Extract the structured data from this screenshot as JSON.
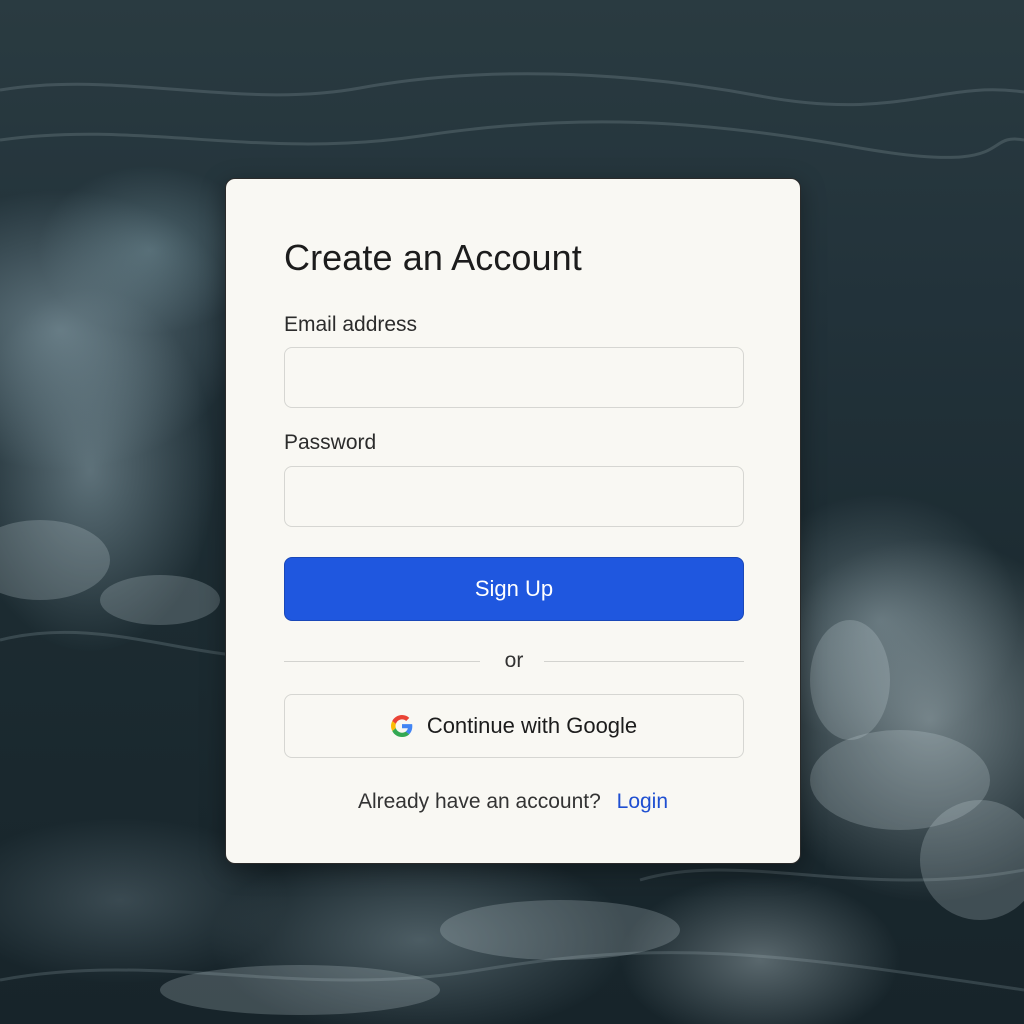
{
  "form": {
    "title": "Create an Account",
    "email_label": "Email address",
    "email_value": "",
    "password_label": "Password",
    "password_value": "",
    "signup_label": "Sign Up",
    "divider_text": "or",
    "google_label": "Continue with Google",
    "google_icon": "google-icon",
    "footer_text": "Already have an account?",
    "login_label": "Login"
  },
  "colors": {
    "accent": "#1f57df",
    "link": "#1f4fd1",
    "card_background": "#f9f8f3"
  }
}
